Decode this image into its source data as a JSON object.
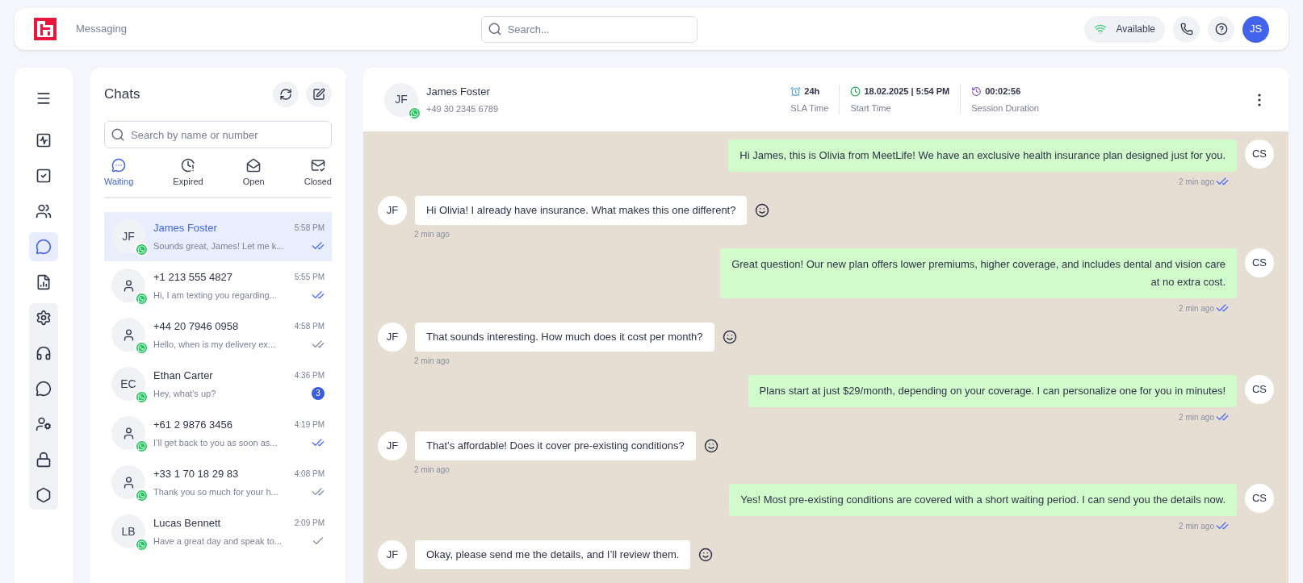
{
  "top_bar": {
    "title": "Messaging",
    "search": {
      "placeholder": "Search..."
    },
    "status": {
      "label": "Available",
      "on": true
    },
    "user_initials": "JS"
  },
  "nav": {
    "items": [
      {
        "selected": false
      },
      {
        "selected": false
      },
      {
        "selected": false
      },
      {
        "selected": false
      },
      {
        "selected": true
      },
      {
        "selected": false
      }
    ],
    "group": [
      {
        "selected": false
      },
      {
        "selected": false
      },
      {
        "selected": false
      },
      {
        "selected": false
      },
      {
        "selected": false
      },
      {
        "selected": false
      }
    ]
  },
  "chats": {
    "title": "Chats",
    "search": {
      "placeholder": "Search by name or number"
    },
    "tabs": [
      {
        "label": "Waiting",
        "selected": true
      },
      {
        "label": "Expired",
        "selected": false
      },
      {
        "label": "Open",
        "selected": false
      },
      {
        "label": "Closed",
        "selected": false
      }
    ],
    "items": [
      {
        "initials": "JF",
        "name": "James Foster",
        "preview": "Sounds great, James! Let me k...",
        "time": "5:58 PM",
        "delivered": true,
        "read": true,
        "selected": true
      },
      {
        "name": "+1 213 555 4827",
        "preview": "Hi, I am texting you regarding...",
        "time": "5:55 PM",
        "delivered": true,
        "read": true,
        "selected": false
      },
      {
        "name": "+44 20 7946 0958",
        "preview": "Hello, when is my delivery ex...",
        "time": "4:58 PM",
        "delivered": true,
        "read": false,
        "selected": false
      },
      {
        "initials": "EC",
        "name": "Ethan Carter",
        "preview": "Hey, what’s up?",
        "time": "4:36 PM",
        "unread": "3",
        "selected": false
      },
      {
        "name": "+61 2 9876 3456",
        "preview": "I’ll get back to you as soon as...",
        "time": "4:19 PM",
        "delivered": true,
        "read": true,
        "selected": false
      },
      {
        "name": "+33 1 70 18 29 83",
        "preview": "Thank you so much for your h...",
        "time": "4:08 PM",
        "delivered": true,
        "read": false,
        "selected": false
      },
      {
        "initials": "LB",
        "name": "Lucas Bennett",
        "preview": "Have a great day and speak to...",
        "time": "2:09 PM",
        "delivered": false,
        "read": false,
        "selected": false
      }
    ]
  },
  "conversation": {
    "contact": {
      "initials": "JF",
      "name": "James Foster",
      "phone": "+49 30 2345 6789"
    },
    "stats": [
      {
        "value": "24h",
        "label": "SLA Time"
      },
      {
        "value": "18.02.2025 | 5:54 PM",
        "label": "Start Time"
      },
      {
        "value": "00:02:56",
        "label": "Session Duration"
      }
    ],
    "messages": [
      {
        "kind": "outgoing",
        "avatar": "CS",
        "text": "Hi James, this is Olivia from MeetLife! We have an exclusive health insurance plan designed just for you.",
        "time": "2 min ago",
        "delivered": true,
        "read": true
      },
      {
        "kind": "incoming",
        "avatar": "JF",
        "text": "Hi Olivia! I already have insurance. What makes this one different?",
        "time": "2 min ago"
      },
      {
        "kind": "outgoing",
        "avatar": "CS",
        "text": "Great question! Our new plan offers lower premiums, higher coverage, and includes dental and vision care at no extra cost.",
        "time": "2 min ago",
        "delivered": true,
        "read": true
      },
      {
        "kind": "incoming",
        "avatar": "JF",
        "text": "That sounds interesting. How much does it cost per month?",
        "time": "2 min ago"
      },
      {
        "kind": "outgoing",
        "avatar": "CS",
        "text": "Plans start at just $29/month, depending on your coverage. I can personalize one for you in minutes!",
        "time": "2 min ago",
        "delivered": true,
        "read": true
      },
      {
        "kind": "incoming",
        "avatar": "JF",
        "text": "That’s affordable! Does it cover pre-existing conditions?",
        "time": "2 min ago"
      },
      {
        "kind": "outgoing",
        "avatar": "CS",
        "text": "Yes! Most pre-existing conditions are covered with a short waiting period. I can send you the details now.",
        "time": "2 min ago",
        "delivered": true,
        "read": true
      },
      {
        "kind": "incoming",
        "avatar": "JF",
        "text": "Okay, please send me the details, and I’ll review them."
      }
    ]
  }
}
